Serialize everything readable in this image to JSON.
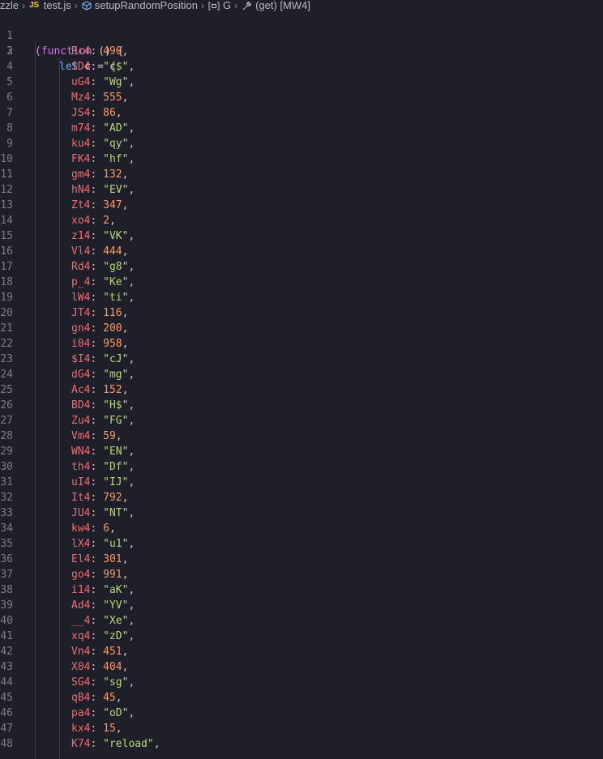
{
  "breadcrumb": {
    "items": [
      {
        "label": "zzle",
        "icon": "folder"
      },
      {
        "label": "test.js",
        "icon": "js-file-icon",
        "badge": "JS"
      },
      {
        "label": "setupRandomPosition",
        "icon": "cube-icon"
      },
      {
        "label": "G",
        "icon": "variable-icon"
      },
      {
        "label": "(get) [MW4]",
        "icon": "wrench-icon"
      }
    ]
  },
  "code": {
    "line1": {
      "num": "1",
      "open": "(",
      "fn": "function",
      "args": " () ",
      "brace": "{"
    },
    "line2": {
      "num": "2",
      "kw": "let",
      "name": " c ",
      "op": "= ",
      "brace": "{"
    },
    "entries": [
      {
        "num": "3",
        "key": "Rc4",
        "value": "490",
        "type": "num"
      },
      {
        "num": "4",
        "key": "SD4",
        "value": "\"c$\"",
        "type": "str"
      },
      {
        "num": "5",
        "key": "uG4",
        "value": "\"Wg\"",
        "type": "str"
      },
      {
        "num": "6",
        "key": "Mz4",
        "value": "555",
        "type": "num"
      },
      {
        "num": "7",
        "key": "JS4",
        "value": "86",
        "type": "num"
      },
      {
        "num": "8",
        "key": "m74",
        "value": "\"AD\"",
        "type": "str"
      },
      {
        "num": "9",
        "key": "ku4",
        "value": "\"qy\"",
        "type": "str"
      },
      {
        "num": "10",
        "key": "FK4",
        "value": "\"hf\"",
        "type": "str"
      },
      {
        "num": "11",
        "key": "gm4",
        "value": "132",
        "type": "num"
      },
      {
        "num": "12",
        "key": "hN4",
        "value": "\"EV\"",
        "type": "str"
      },
      {
        "num": "13",
        "key": "Zt4",
        "value": "347",
        "type": "num"
      },
      {
        "num": "14",
        "key": "xo4",
        "value": "2",
        "type": "num"
      },
      {
        "num": "15",
        "key": "z14",
        "value": "\"VK\"",
        "type": "str"
      },
      {
        "num": "16",
        "key": "Vl4",
        "value": "444",
        "type": "num"
      },
      {
        "num": "17",
        "key": "Rd4",
        "value": "\"g8\"",
        "type": "str"
      },
      {
        "num": "18",
        "key": "p_4",
        "value": "\"Ke\"",
        "type": "str"
      },
      {
        "num": "19",
        "key": "lW4",
        "value": "\"ti\"",
        "type": "str"
      },
      {
        "num": "20",
        "key": "JT4",
        "value": "116",
        "type": "num"
      },
      {
        "num": "21",
        "key": "gn4",
        "value": "200",
        "type": "num"
      },
      {
        "num": "22",
        "key": "i04",
        "value": "958",
        "type": "num"
      },
      {
        "num": "23",
        "key": "$I4",
        "value": "\"cJ\"",
        "type": "str"
      },
      {
        "num": "24",
        "key": "dG4",
        "value": "\"mg\"",
        "type": "str"
      },
      {
        "num": "25",
        "key": "Ac4",
        "value": "152",
        "type": "num"
      },
      {
        "num": "26",
        "key": "BD4",
        "value": "\"H$\"",
        "type": "str"
      },
      {
        "num": "27",
        "key": "Zu4",
        "value": "\"FG\"",
        "type": "str"
      },
      {
        "num": "28",
        "key": "Vm4",
        "value": "59",
        "type": "num"
      },
      {
        "num": "29",
        "key": "WN4",
        "value": "\"EN\"",
        "type": "str"
      },
      {
        "num": "30",
        "key": "th4",
        "value": "\"Df\"",
        "type": "str"
      },
      {
        "num": "31",
        "key": "uI4",
        "value": "\"IJ\"",
        "type": "str"
      },
      {
        "num": "32",
        "key": "It4",
        "value": "792",
        "type": "num"
      },
      {
        "num": "33",
        "key": "JU4",
        "value": "\"NT\"",
        "type": "str"
      },
      {
        "num": "34",
        "key": "kw4",
        "value": "6",
        "type": "num"
      },
      {
        "num": "35",
        "key": "lX4",
        "value": "\"u1\"",
        "type": "str"
      },
      {
        "num": "36",
        "key": "El4",
        "value": "301",
        "type": "num"
      },
      {
        "num": "37",
        "key": "go4",
        "value": "991",
        "type": "num"
      },
      {
        "num": "38",
        "key": "i14",
        "value": "\"aK\"",
        "type": "str"
      },
      {
        "num": "39",
        "key": "Ad4",
        "value": "\"YV\"",
        "type": "str"
      },
      {
        "num": "40",
        "key": "__4",
        "value": "\"Xe\"",
        "type": "str"
      },
      {
        "num": "41",
        "key": "xq4",
        "value": "\"zD\"",
        "type": "str"
      },
      {
        "num": "42",
        "key": "Vn4",
        "value": "451",
        "type": "num"
      },
      {
        "num": "43",
        "key": "X04",
        "value": "404",
        "type": "num"
      },
      {
        "num": "44",
        "key": "SG4",
        "value": "\"sg\"",
        "type": "str"
      },
      {
        "num": "45",
        "key": "qB4",
        "value": "45",
        "type": "num"
      },
      {
        "num": "46",
        "key": "pa4",
        "value": "\"oD\"",
        "type": "str"
      },
      {
        "num": "47",
        "key": "kx4",
        "value": "15",
        "type": "num"
      },
      {
        "num": "48",
        "key": "K74",
        "value": "\"reload\"",
        "type": "str"
      }
    ]
  },
  "colors": {
    "background": "#1f1f29",
    "key": "#f06b73",
    "number": "#f59b6c",
    "string": "#b5d67e",
    "keyword": "#6ea9f0",
    "line_number": "#7c7c8c"
  }
}
